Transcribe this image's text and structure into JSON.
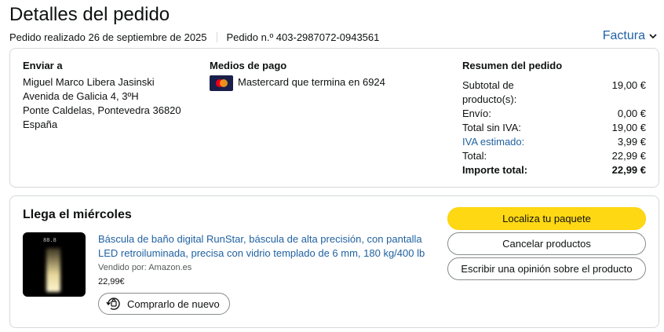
{
  "header": {
    "title": "Detalles del pedido",
    "order_date": "Pedido realizado 26 de septiembre de 2025",
    "order_number": "Pedido n.º 403-2987072-0943561",
    "invoice_label": "Factura"
  },
  "summary": {
    "ship_to": {
      "heading": "Enviar a",
      "lines": [
        "Miguel Marco Libera Jasinski",
        "Avenida de Galicia 4, 3ºH",
        "Ponte Caldelas, Pontevedra 36820",
        "España"
      ]
    },
    "payment": {
      "heading": "Medios de pago",
      "card_logo_text": "MasterCard",
      "text": "Mastercard que termina en 6924"
    },
    "totals": {
      "heading": "Resumen del pedido",
      "rows": [
        {
          "label": "Subtotal de producto(s):",
          "value": "19,00 €"
        },
        {
          "label": "Envío:",
          "value": "0,00 €"
        },
        {
          "label": "Total sin IVA:",
          "value": "19,00 €"
        },
        {
          "label": "IVA estimado:",
          "value": "3,99 €"
        },
        {
          "label": "Total:",
          "value": "22,99 €"
        },
        {
          "label": "Importe total:",
          "value": "22,99 €"
        }
      ]
    }
  },
  "shipment": {
    "title": "Llega el miércoles",
    "product": {
      "name": "Báscula de baño digital RunStar, báscula de alta precisión, con pantalla LED retroiluminada, precisa con vidrio templado de 6 mm, 180 kg/400 lb",
      "seller": "Vendido por: Amazon.es",
      "price": "22,99€",
      "display_reading": "88.8",
      "rebuy_label": "Comprarlo de nuevo"
    },
    "actions": {
      "track": "Localiza tu paquete",
      "cancel": "Cancelar productos",
      "review": "Escribir una opinión sobre el producto"
    }
  },
  "colors": {
    "link": "#2162a1",
    "primary_button": "#ffd814",
    "border": "#d5d9d9"
  }
}
